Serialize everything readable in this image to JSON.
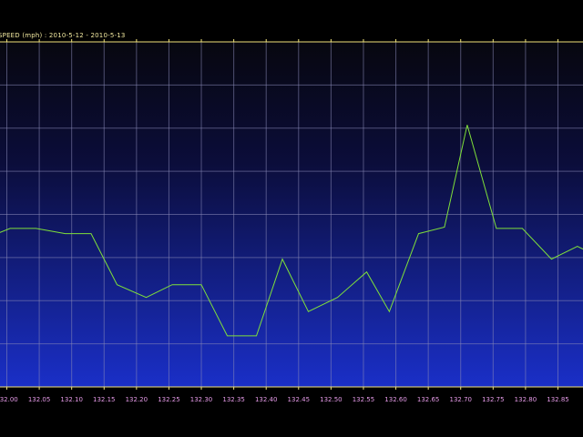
{
  "chart_data": {
    "type": "line",
    "title": "SPEED (mph) : 2010-5-12 - 2010-5-13",
    "xlabel": "",
    "ylabel": "",
    "x_ticks": [
      "132.00",
      "132.05",
      "132.10",
      "132.15",
      "132.20",
      "132.25",
      "132.30",
      "132.35",
      "132.40",
      "132.45",
      "132.50",
      "132.55",
      "132.60",
      "132.65",
      "132.70",
      "132.75",
      "132.80",
      "132.85"
    ],
    "xlim": [
      132.0,
      132.885
    ],
    "grid": true,
    "series": [
      {
        "color": "#7fe03a",
        "x": [
          131.985,
          132.005,
          132.045,
          132.09,
          132.13,
          132.17,
          132.215,
          132.255,
          132.3,
          132.34,
          132.385,
          132.425,
          132.465,
          132.51,
          132.555,
          132.59,
          132.635,
          132.675,
          132.71,
          132.755,
          132.795,
          132.84,
          132.88,
          132.9
        ],
        "values": [
          6.0,
          6.4,
          6.4,
          6.0,
          6.0,
          2.0,
          1.0,
          2.0,
          2.0,
          -2.0,
          -2.0,
          4.0,
          -0.1,
          1.0,
          3.0,
          -0.1,
          6.0,
          6.5,
          14.5,
          6.4,
          6.4,
          4.0,
          5.0,
          4.5
        ]
      }
    ],
    "ylim": [
      -6,
      21
    ]
  }
}
